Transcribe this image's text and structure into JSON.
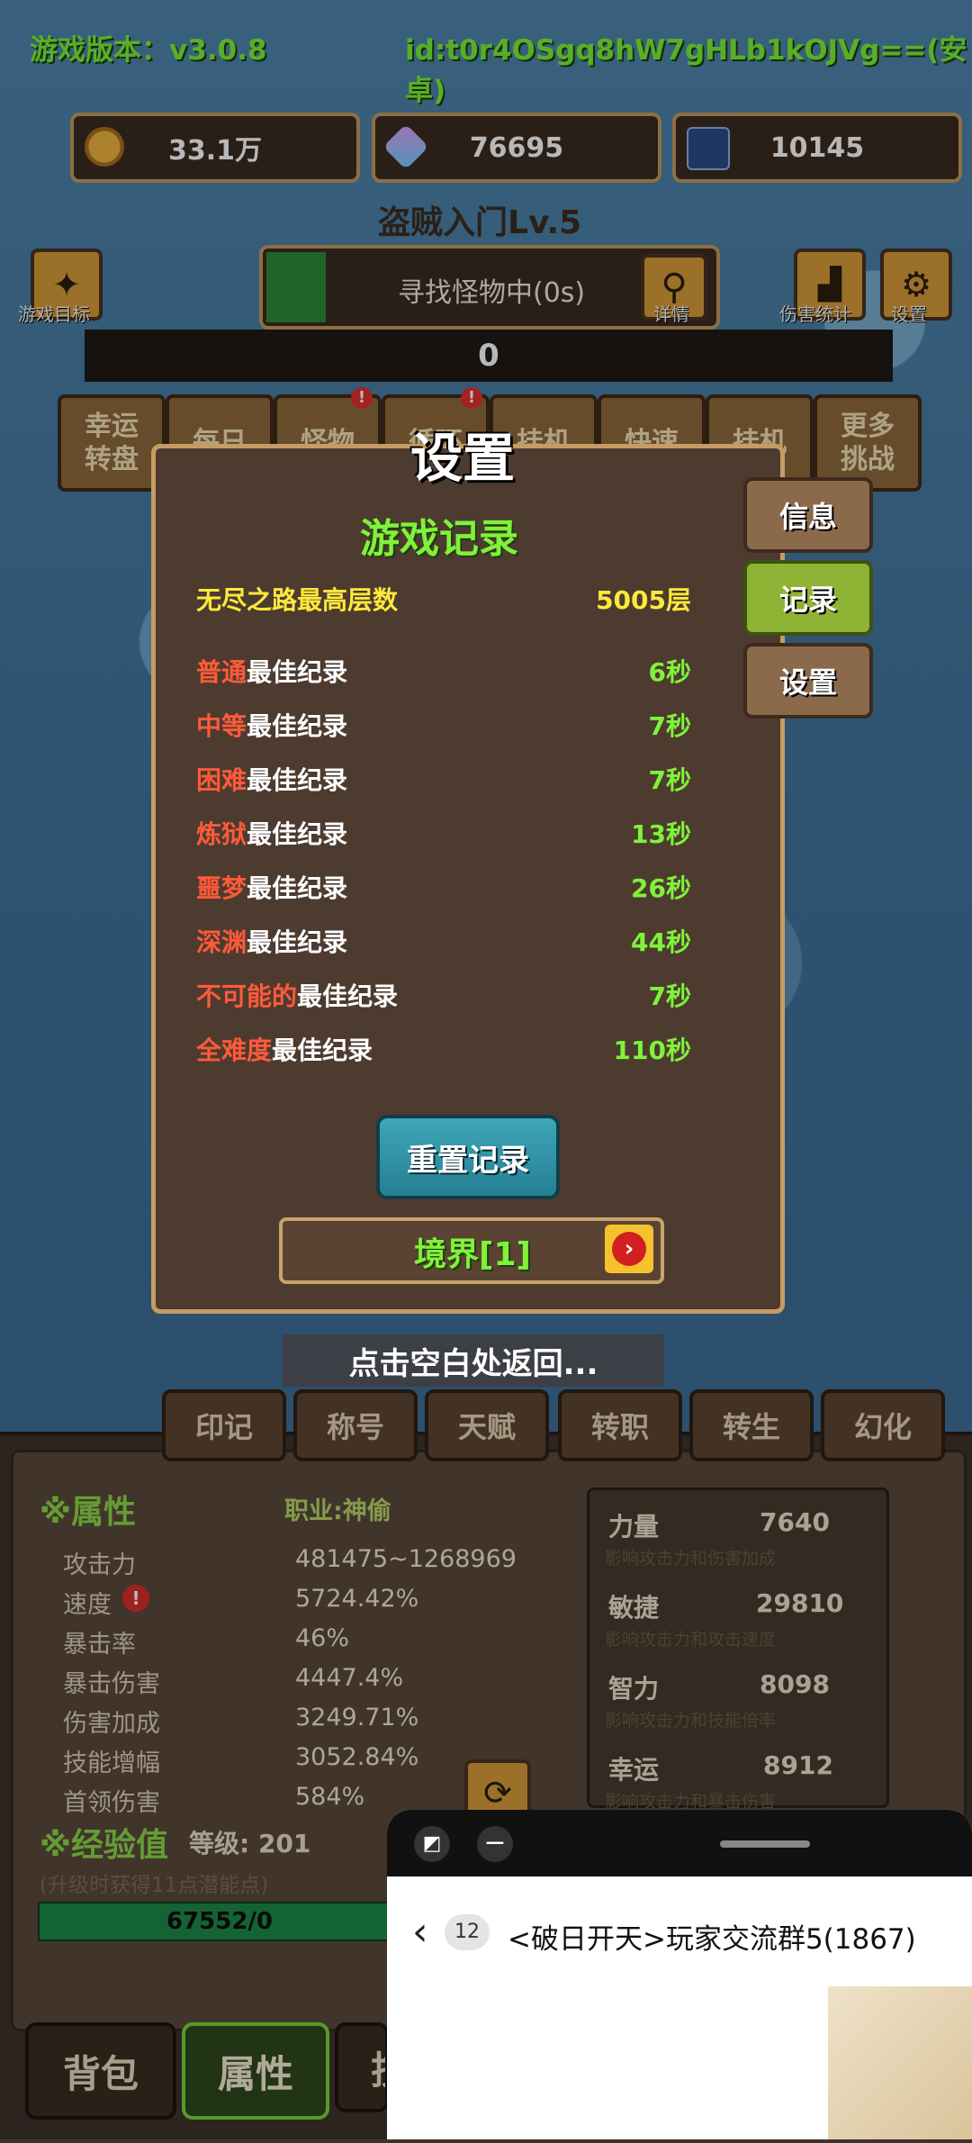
{
  "header": {
    "version": "游戏版本：v3.0.8",
    "device_id": "id:t0r4OSgq8hW7gHLb1kOJVg==(安卓)"
  },
  "resources": {
    "gold": "33.1万",
    "crystal": "76695",
    "card": "10145"
  },
  "player_title": "盗贼入门Lv.5",
  "top_actions": {
    "goal_label": "游戏目标",
    "search_status": "寻找怪物中(0s)",
    "detail_label": "详情",
    "damage_stats_label": "伤害统计",
    "settings_label": "设置"
  },
  "progress_value": "0",
  "menu_buttons": [
    {
      "line1": "幸运",
      "line2": "转盘"
    },
    {
      "line1": "每日",
      "line2": ""
    },
    {
      "line1": "怪物",
      "line2": ""
    },
    {
      "line1": "循环",
      "line2": ""
    },
    {
      "line1": "挂机",
      "line2": ""
    },
    {
      "line1": "快速",
      "line2": ""
    },
    {
      "line1": "挂机",
      "line2": ""
    },
    {
      "line1": "更多",
      "line2": "挑战"
    }
  ],
  "settings_dialog": {
    "title": "设置",
    "section_title": "游戏记录",
    "endless": {
      "label": "无尽之路最高层数",
      "value": "5005层"
    },
    "records": [
      {
        "diff": "普通",
        "suffix": "最佳纪录",
        "value": "6秒"
      },
      {
        "diff": "中等",
        "suffix": "最佳纪录",
        "value": "7秒"
      },
      {
        "diff": "困难",
        "suffix": "最佳纪录",
        "value": "7秒"
      },
      {
        "diff": "炼狱",
        "suffix": "最佳纪录",
        "value": "13秒"
      },
      {
        "diff": "噩梦",
        "suffix": "最佳纪录",
        "value": "26秒"
      },
      {
        "diff": "深渊",
        "suffix": "最佳纪录",
        "value": "44秒"
      },
      {
        "diff": "不可能的",
        "suffix": "最佳纪录",
        "value": "7秒"
      },
      {
        "diff": "全难度",
        "suffix": "最佳纪录",
        "value": "110秒"
      }
    ],
    "reset_button": "重置记录",
    "realm_button": "境界[1]",
    "side_tabs": {
      "info": "信息",
      "record": "记录",
      "settings": "设置"
    }
  },
  "dismiss_hint": "点击空白处返回...",
  "bottom_tabs": [
    "印记",
    "称号",
    "天赋",
    "转职",
    "转生",
    "幻化"
  ],
  "attributes": {
    "header": "※属性",
    "job": "职业:神偷",
    "rows": [
      {
        "label": "攻击力",
        "value": "481475~1268969"
      },
      {
        "label": "速度",
        "value": "5724.42%"
      },
      {
        "label": "暴击率",
        "value": "46%"
      },
      {
        "label": "暴击伤害",
        "value": "4447.4%"
      },
      {
        "label": "伤害加成",
        "value": "3249.71%"
      },
      {
        "label": "技能增幅",
        "value": "3052.84%"
      },
      {
        "label": "首领伤害",
        "value": "584%"
      }
    ],
    "stats": [
      {
        "label": "力量",
        "value": "7640",
        "desc": "影响攻击力和伤害加成"
      },
      {
        "label": "敏捷",
        "value": "29810",
        "desc": "影响攻击力和攻击速度"
      },
      {
        "label": "智力",
        "value": "8098",
        "desc": "影响攻击力和技能倍率"
      },
      {
        "label": "幸运",
        "value": "8912",
        "desc": "影响攻击力和暴击伤害"
      }
    ],
    "exp_header": "※经验值",
    "level": "等级: 201",
    "exp_hint": "(升级时获得11点潜能点)",
    "exp_value": "67552/0"
  },
  "bottom_nav": [
    "背包",
    "属性",
    "技"
  ],
  "floating_window": {
    "badge": "12",
    "chat_title": "<破日开天>玩家交流群5(1867)"
  },
  "colors": {
    "accent_green": "#7ff23a",
    "difficulty_red": "#ff5a3a",
    "panel_brown": "#4d3b30",
    "border_gold": "#c69c62"
  }
}
